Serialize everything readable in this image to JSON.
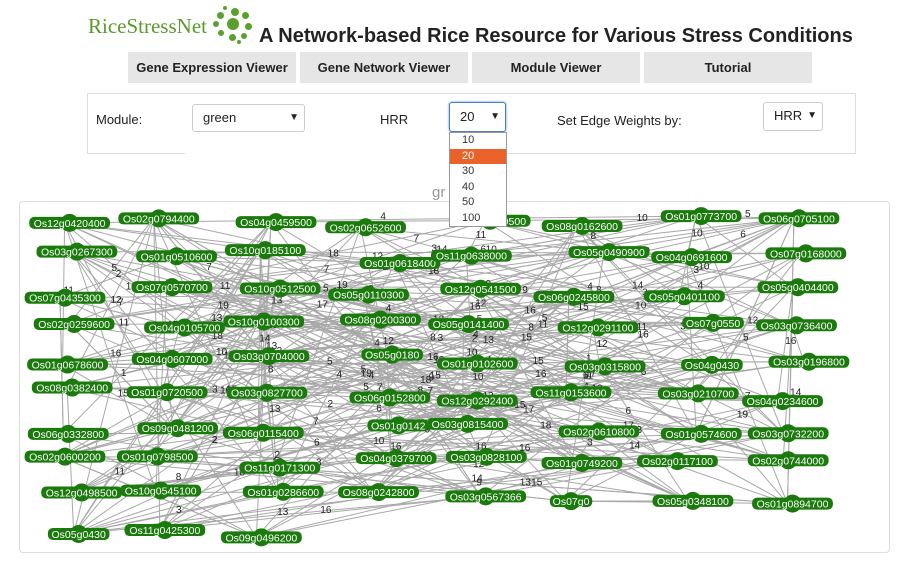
{
  "header": {
    "logo_text": "RiceStressNet",
    "title": "A Network-based Rice Resource for Various Stress Conditions"
  },
  "nav": {
    "items": [
      "Gene Expression Viewer",
      "Gene Network Viewer",
      "Module Viewer",
      "Tutorial"
    ]
  },
  "controls": {
    "module_label": "Module:",
    "module_value": "green",
    "hrr_label": "HRR",
    "hrr_value": "20",
    "hrr_options": [
      "10",
      "20",
      "30",
      "40",
      "50",
      "100"
    ],
    "edge_label": "Set Edge Weights by:",
    "edge_value": "HRR"
  },
  "graph": {
    "title": "gr",
    "node_color": "#1a7a0c",
    "edge_color": "#a8a8a8",
    "nodes": [
      "Os12g0420400",
      "Os02g0794400",
      "Os04g0459500",
      "Os02g0652600",
      "Os09g0279500",
      "Os08g0162600",
      "Os01g0773700",
      "Os06g0705100",
      "Os03g0267300",
      "Os01g0510600",
      "Os10g0185100",
      "Os01g0618400",
      "Os11g0638000",
      "Os05g0490900",
      "Os04g0691600",
      "Os07g0168000",
      "Os07g0435300",
      "Os07g0570700",
      "Os10g0512500",
      "Os05g0110300",
      "Os12g0541500",
      "Os06g0245800",
      "Os05g0401100",
      "Os05g0404400",
      "Os02g0259600",
      "Os04g0105700",
      "Os10g0100300",
      "Os08g0200300",
      "Os05g0141400",
      "Os12g0291100",
      "Os07g0550",
      "Os03g0736400",
      "Os01g0678600",
      "Os04g0607000",
      "Os03g0704000",
      "Os05g0180",
      "Os01g0102600",
      "Os03g0315800",
      "Os04g0430",
      "Os03g0196800",
      "Os08g0382400",
      "Os01g0720500",
      "Os03g0827700",
      "Os06g0152800",
      "Os12g0292400",
      "Os11g0153600",
      "Os03g0210700",
      "Os04g0234600",
      "Os06g0332800",
      "Os09g0481200",
      "Os06g0115400",
      "Os01g0142",
      "Os03g0815400",
      "Os02g0610800",
      "Os01g0574600",
      "Os03g0732200",
      "Os02g0600200",
      "Os01g0798500",
      "Os11g0171300",
      "Os04g0379700",
      "Os03g0828100",
      "Os01g0749200",
      "Os02g0117100",
      "Os02g0744000",
      "Os12g0498500",
      "Os10g0545100",
      "Os01g0286600",
      "Os08g0242800",
      "Os03g0567366",
      "Os07g0",
      "Os05g0348100",
      "Os01g0894700",
      "Os05g0430",
      "Os11g0425300",
      "Os09g0496200"
    ]
  }
}
